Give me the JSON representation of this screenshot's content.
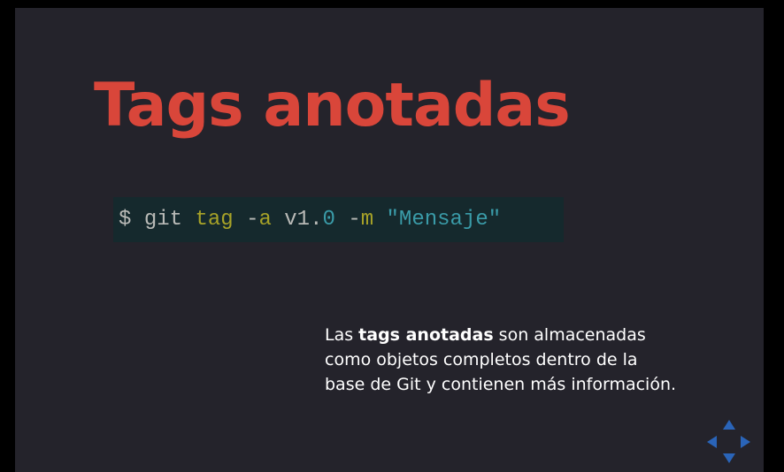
{
  "slide": {
    "title": "Tags anotadas",
    "code": {
      "prompt": "$",
      "cmd": "git",
      "subcmd": "tag",
      "flag_a": "-a",
      "version": "v1.0",
      "flag_m": "-m",
      "message": "\"Mensaje\""
    },
    "description": {
      "prefix": "Las ",
      "bold": "tags anotadas",
      "suffix": " son almacenadas como objetos completos dentro de la base de Git y contienen más información."
    }
  },
  "navigation": {
    "up_icon": "arrow-up-icon",
    "down_icon": "arrow-down-icon",
    "left_icon": "arrow-left-icon",
    "right_icon": "arrow-right-icon"
  },
  "colors": {
    "background": "#24232b",
    "title": "#d9463a",
    "code_bg": "#15292d",
    "keyword": "#a7a228",
    "string": "#3a9ba8",
    "nav": "#2a64b8"
  }
}
